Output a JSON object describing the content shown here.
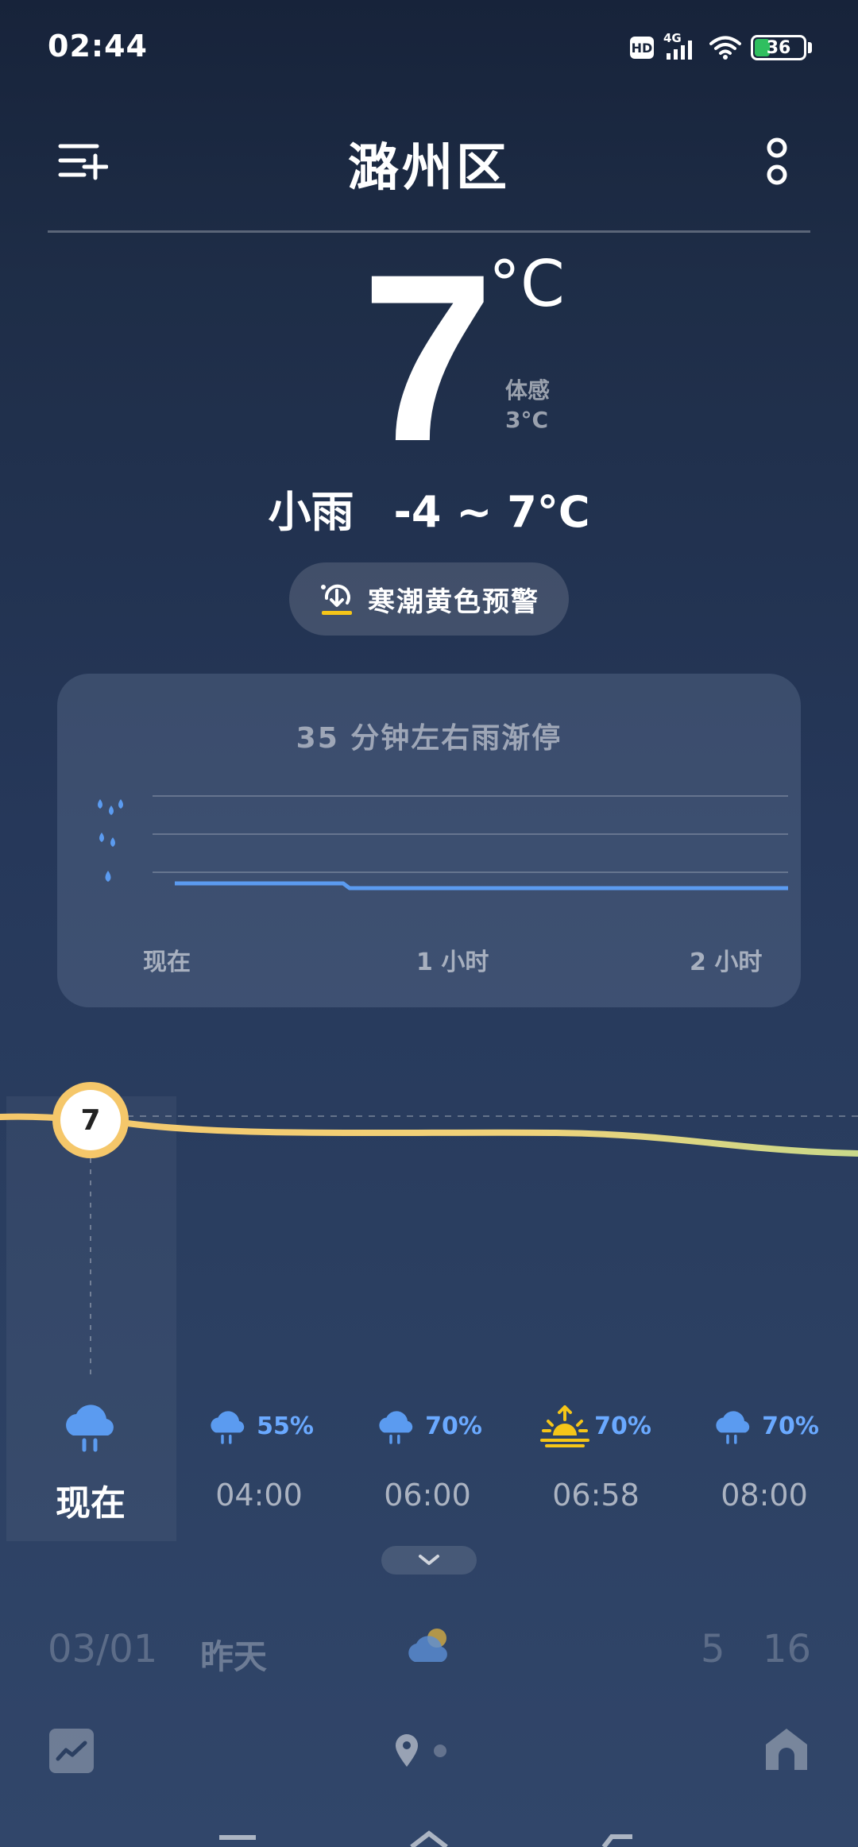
{
  "status_bar": {
    "time": "02:44",
    "hd": "HD",
    "network": "4G",
    "battery": "36",
    "battery_level": 0.36
  },
  "header": {
    "title": "潞州区",
    "menu_icon": "list-add-icon",
    "more_icon": "more-icon"
  },
  "current": {
    "temperature": "7",
    "unit": "°C",
    "feels_like_label": "体感",
    "feels_like_value": "3°C",
    "condition": "小雨",
    "range": "-4 ~ 7°C"
  },
  "warning": {
    "text": "寒潮黄色预警",
    "icon": "cold-wave-icon",
    "color": "#f5c518"
  },
  "precip_card": {
    "title": "35 分钟左右雨渐停",
    "ticks": [
      "现在",
      "1 小时",
      "2 小时"
    ],
    "line_color": "#5b9bf0"
  },
  "hourly": {
    "current_temp": "7",
    "items": [
      {
        "time": "现在",
        "icon": "rain-cloud-icon",
        "pct": ""
      },
      {
        "time": "04:00",
        "icon": "rain-cloud-icon",
        "pct": "55%"
      },
      {
        "time": "06:00",
        "icon": "rain-cloud-icon",
        "pct": "70%"
      },
      {
        "time": "06:58",
        "icon": "sunrise-icon",
        "pct": "70%"
      },
      {
        "time": "08:00",
        "icon": "rain-cloud-icon",
        "pct": "70%"
      }
    ]
  },
  "daily": {
    "date": "03/01",
    "day": "昨天",
    "icon": "partly-cloudy-icon",
    "low": "5",
    "high": "16"
  },
  "bottom_bar": {
    "trend_icon": "trend-icon",
    "location_icon": "location-pin-icon",
    "home_icon": "home-icon"
  }
}
